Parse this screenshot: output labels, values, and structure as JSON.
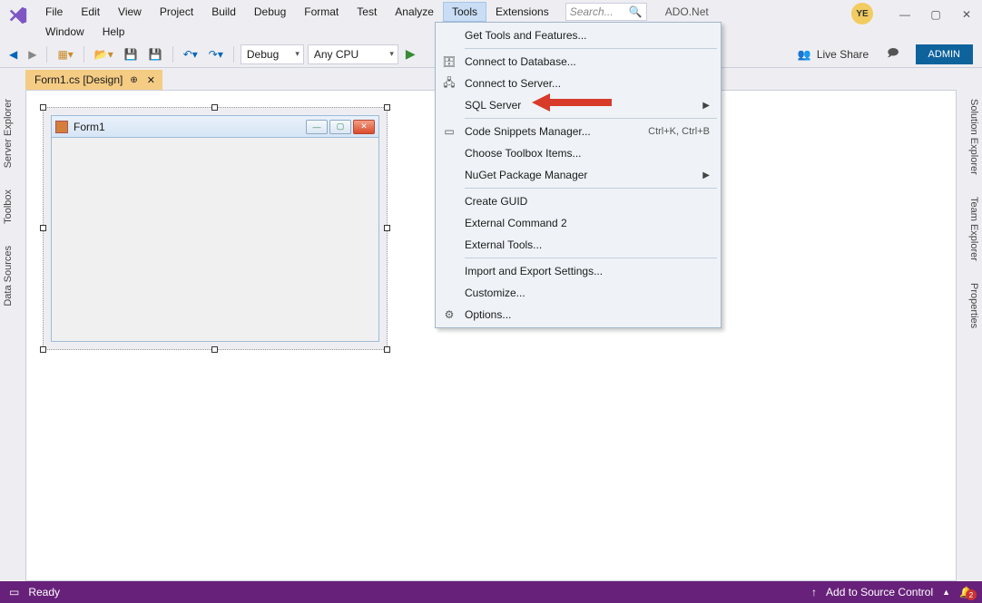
{
  "menus": {
    "row1": [
      "File",
      "Edit",
      "View",
      "Project",
      "Build",
      "Debug",
      "Format",
      "Test",
      "Analyze",
      "Tools",
      "Extensions"
    ],
    "row2": [
      "Window",
      "Help"
    ]
  },
  "search": {
    "placeholder": "Search..."
  },
  "project_label": "ADO.Net",
  "user_badge": "YE",
  "toolbar": {
    "config": "Debug",
    "platform": "Any CPU",
    "live_share": "Live Share",
    "admin": "ADMIN"
  },
  "tab": {
    "label": "Form1.cs [Design]"
  },
  "vertical_tabs_left": [
    "Server Explorer",
    "Toolbox",
    "Data Sources"
  ],
  "vertical_tabs_right": [
    "Solution Explorer",
    "Team Explorer",
    "Properties"
  ],
  "form": {
    "title": "Form1"
  },
  "tools_menu": {
    "get_tools": "Get Tools and Features...",
    "connect_db": "Connect to Database...",
    "connect_server": "Connect to Server...",
    "sql_server": "SQL Server",
    "code_snippets": "Code Snippets Manager...",
    "code_snippets_sc": "Ctrl+K, Ctrl+B",
    "choose_toolbox": "Choose Toolbox Items...",
    "nuget": "NuGet Package Manager",
    "create_guid": "Create GUID",
    "ext_cmd2": "External Command 2",
    "ext_tools": "External Tools...",
    "import_export": "Import and Export Settings...",
    "customize": "Customize...",
    "options": "Options..."
  },
  "status": {
    "ready": "Ready",
    "source_control": "Add to Source Control",
    "notif_count": "2"
  }
}
